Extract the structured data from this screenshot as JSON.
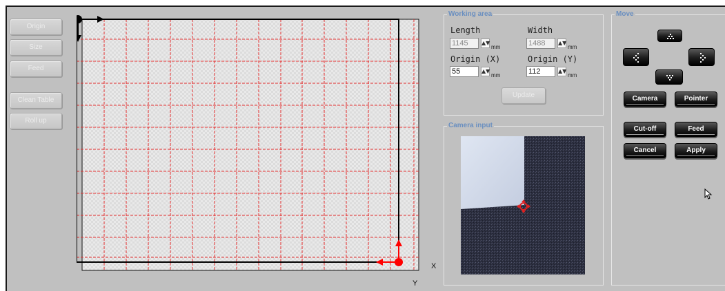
{
  "left_toolbar": {
    "origin_label": "Origin",
    "size_label": "Size",
    "feed_label": "Feed",
    "clean_table_label": "Clean Table",
    "roll_up_label": "Roll up"
  },
  "table": {
    "x_axis_label": "X",
    "y_axis_label": "Y"
  },
  "working_area": {
    "title": "Working area",
    "length_label": "Length",
    "width_label": "Width",
    "origin_x_label": "Origin (X)",
    "origin_y_label": "Origin (Y)",
    "length_value": "1145",
    "width_value": "1488",
    "origin_x_value": "55",
    "origin_y_value": "112",
    "unit": "mm",
    "update_label": "Update"
  },
  "camera_input": {
    "title": "Camera input"
  },
  "move": {
    "title": "Move",
    "camera_label": "Camera",
    "pointer_label": "Pointer",
    "cut_off_label": "Cut-off",
    "feed_label": "Feed",
    "cancel_label": "Cancel",
    "apply_label": "Apply"
  },
  "colors": {
    "panel_title": "#6a8fc0",
    "grid_line": "#e53030",
    "marker": "#ff0000"
  }
}
